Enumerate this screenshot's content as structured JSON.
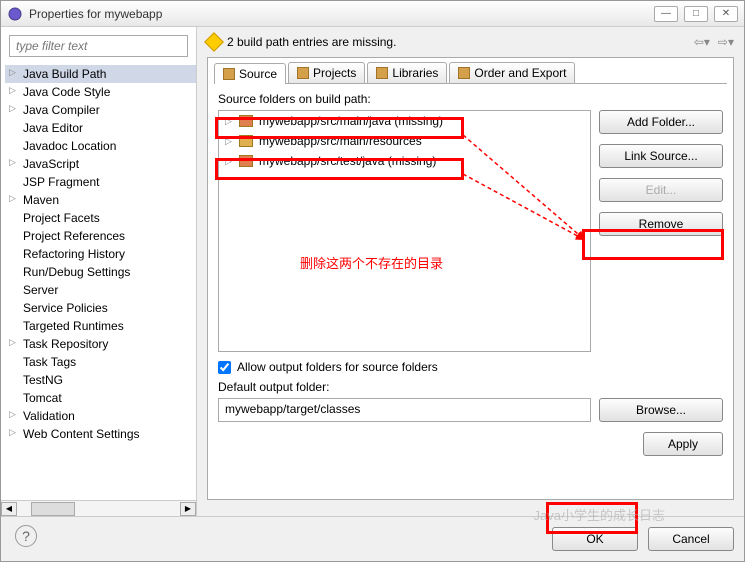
{
  "window": {
    "title": "Properties for mywebapp"
  },
  "filter": {
    "placeholder": "type filter text"
  },
  "nav_items": [
    "Java Build Path",
    "Java Code Style",
    "Java Compiler",
    "Java Editor",
    "Javadoc Location",
    "JavaScript",
    "JSP Fragment",
    "Maven",
    "Project Facets",
    "Project References",
    "Refactoring History",
    "Run/Debug Settings",
    "Server",
    "Service Policies",
    "Targeted Runtimes",
    "Task Repository",
    "Task Tags",
    "TestNG",
    "Tomcat",
    "Validation",
    "Web Content Settings"
  ],
  "warning": "2 build path entries are missing.",
  "tabs": {
    "source": "Source",
    "projects": "Projects",
    "libraries": "Libraries",
    "order": "Order and Export"
  },
  "source_label": "Source folders on build path:",
  "src_items": [
    {
      "label": "mywebapp/src/main/java (missing)",
      "err": true
    },
    {
      "label": "mywebapp/src/main/resources",
      "err": false
    },
    {
      "label": "mywebapp/src/test/java (missing)",
      "err": true
    }
  ],
  "buttons": {
    "add_folder": "Add Folder...",
    "link_source": "Link Source...",
    "edit": "Edit...",
    "remove": "Remove",
    "browse": "Browse...",
    "apply": "Apply",
    "ok": "OK",
    "cancel": "Cancel"
  },
  "allow_output": "Allow output folders for source folders",
  "default_output_label": "Default output folder:",
  "default_output_value": "mywebapp/target/classes",
  "annotation_text": "删除这两个不存在的目录",
  "watermark": "Java小学生的成长日志"
}
